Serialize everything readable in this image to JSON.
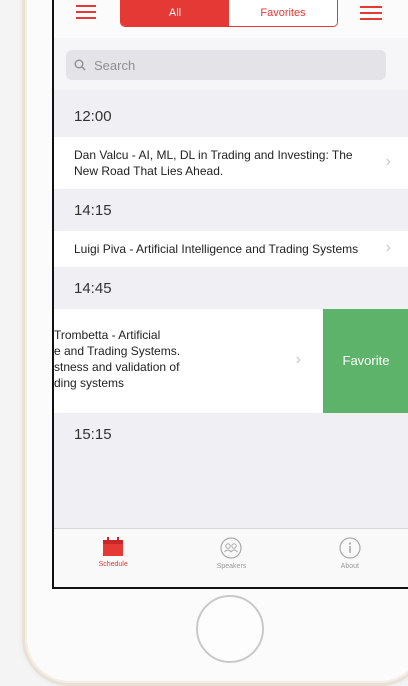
{
  "nav": {
    "segments": [
      "All",
      "Favorites"
    ],
    "active_segment": "All"
  },
  "search": {
    "placeholder": "Search"
  },
  "schedule": [
    {
      "time": "12:00",
      "talks": [
        {
          "title": "Dan Valcu - AI, ML, DL in Trading and Investing: The New Road That Lies Ahead."
        }
      ]
    },
    {
      "time": "14:15",
      "talks": [
        {
          "title": "Luigi Piva - Artificial Intelligence and Trading Systems"
        }
      ]
    },
    {
      "time": "14:45",
      "talks": [
        {
          "title_lines": [
            "Trombetta - Artificial",
            "e and Trading Systems.",
            "stness and validation of",
            "ding systems"
          ],
          "swipe_action": "Favorite"
        }
      ]
    },
    {
      "time": "15:15",
      "talks": []
    }
  ],
  "tabbar": [
    {
      "label": "Schedule",
      "icon": "calendar-icon",
      "active": true
    },
    {
      "label": "Speakers",
      "icon": "speakers-icon",
      "active": false
    },
    {
      "label": "About",
      "icon": "info-icon",
      "active": false
    }
  ],
  "colors": {
    "accent": "#e53935",
    "favorite": "#5eb36a",
    "background": "#efeff4"
  }
}
